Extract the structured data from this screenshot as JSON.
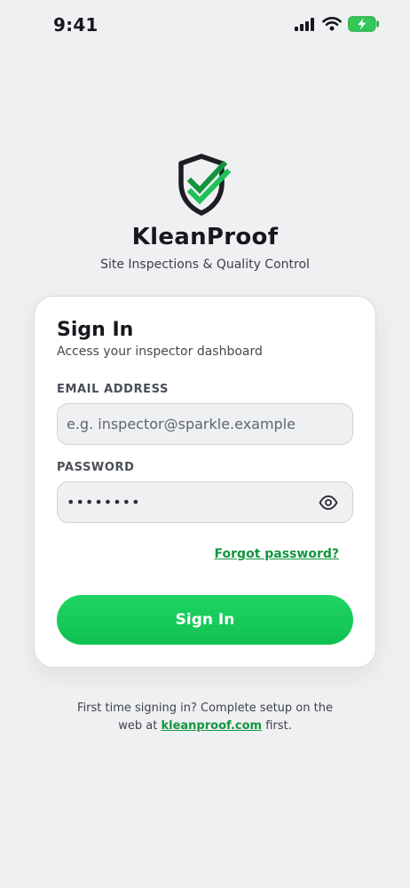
{
  "status_bar": {
    "time": "9:41",
    "signal_icon": "cellular-signal-icon",
    "wifi_icon": "wifi-icon",
    "battery_icon": "battery-charging-icon",
    "battery_color": "#34c759"
  },
  "brand": {
    "logo_icon": "shield-check-icon",
    "name": "KleanProof",
    "tagline": "Site Inspections & Quality Control",
    "accent_color": "#13953f"
  },
  "sign_in": {
    "title": "Sign In",
    "subtitle": "Access your inspector dashboard",
    "email": {
      "label": "EMAIL ADDRESS",
      "value": "",
      "placeholder": "e.g. inspector@sparkle.example"
    },
    "password": {
      "label": "PASSWORD",
      "value": "••••••••",
      "toggle_icon": "eye-icon"
    },
    "forgot_link": "Forgot password?",
    "submit_label": "Sign In",
    "submit_color": "#16c85a"
  },
  "footer": {
    "line1": "First time signing in? Complete setup on the",
    "prefix": "web at ",
    "link": "kleanproof.com",
    "suffix": " first."
  }
}
